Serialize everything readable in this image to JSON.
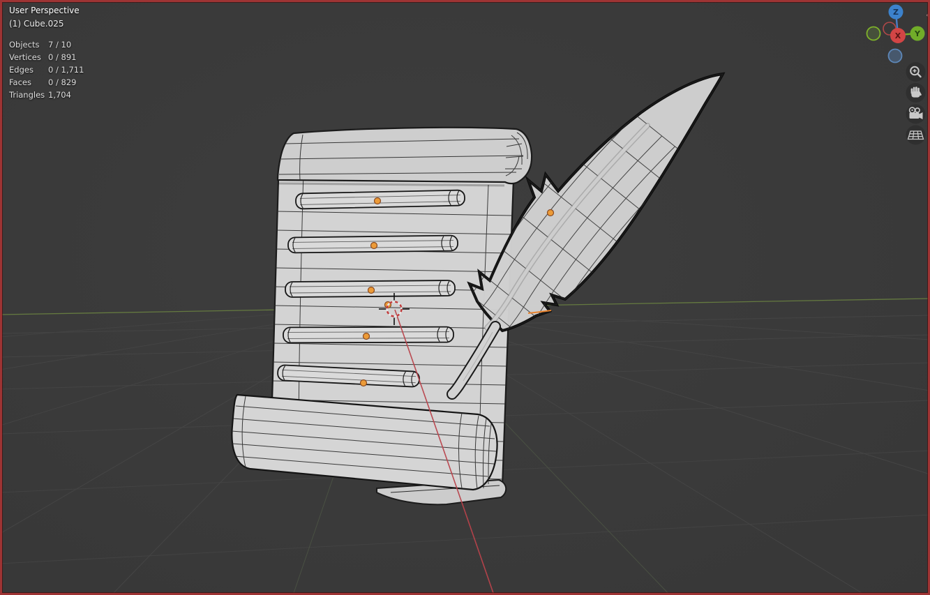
{
  "viewport": {
    "view_label": "User Perspective",
    "object_label": "(1) Cube.025",
    "stats": [
      {
        "label": "Objects",
        "value": "7 / 10"
      },
      {
        "label": "Vertices",
        "value": "0 / 891"
      },
      {
        "label": "Edges",
        "value": "0 / 1,711"
      },
      {
        "label": "Faces",
        "value": "0 / 829"
      },
      {
        "label": "Triangles",
        "value": "1,704"
      }
    ]
  },
  "gizmo": {
    "x_label": "X",
    "y_label": "Y",
    "z_label": "Z"
  },
  "nav_toolbar": {
    "icons": [
      {
        "name": "zoom-icon"
      },
      {
        "name": "pan-hand-icon"
      },
      {
        "name": "camera-view-icon"
      },
      {
        "name": "toggle-perspective-icon"
      }
    ]
  },
  "sidebar_toggle": {
    "glyph": "‹"
  },
  "colors": {
    "background": "#3a3a3a",
    "frame_border": "#9e3434",
    "axis_x_line": "#b9434b",
    "axis_y_line": "#657a40",
    "gizmo_x": "#d24545",
    "gizmo_y": "#71ad29",
    "gizmo_z": "#3c82cc",
    "origin_dot": "#ec9b38",
    "selection_outline": "#e8822c",
    "model_fill": "#d2d2d2",
    "wireframe": "#1d1d1d"
  }
}
